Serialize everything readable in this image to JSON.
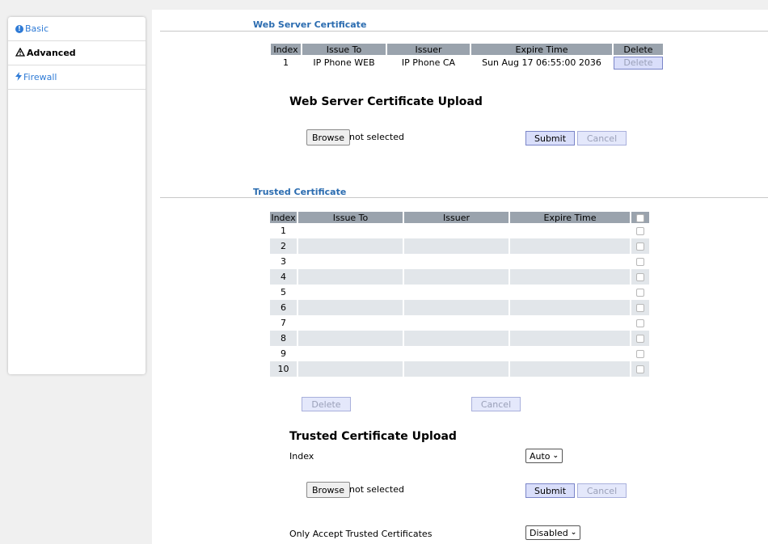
{
  "sidebar": {
    "items": [
      {
        "label": "Basic"
      },
      {
        "label": "Advanced"
      },
      {
        "label": "Firewall"
      }
    ]
  },
  "web_server": {
    "title": "Web Server Certificate",
    "columns": [
      "Index",
      "Issue To",
      "Issuer",
      "Expire Time",
      "Delete"
    ],
    "rows": [
      {
        "index": "1",
        "issue_to": "IP Phone WEB",
        "issuer": "IP Phone CA",
        "expire": "Sun Aug 17 06:55:00 2036",
        "delete_label": "Delete"
      }
    ],
    "upload_heading": "Web Server Certificate Upload",
    "browse_label": "Browse",
    "file_status": "not selected",
    "submit_label": "Submit",
    "cancel_label": "Cancel"
  },
  "trusted": {
    "title": "Trusted Certificate",
    "columns": [
      "Index",
      "Issue To",
      "Issuer",
      "Expire Time"
    ],
    "rows": [
      "1",
      "2",
      "3",
      "4",
      "5",
      "6",
      "7",
      "8",
      "9",
      "10"
    ],
    "delete_label": "Delete",
    "cancel_label": "Cancel",
    "upload_heading": "Trusted Certificate Upload",
    "index_label": "Index",
    "index_value": "Auto",
    "browse_label": "Browse",
    "file_status": "not selected",
    "submit_label": "Submit",
    "upload_cancel_label": "Cancel",
    "only_accept_label": "Only Accept Trusted Certificates",
    "only_accept_value": "Disabled"
  },
  "colors": {
    "link": "#2f7bd6",
    "section_title": "#2b6cb0",
    "header_bg": "#9aa3ad",
    "row_alt": "#e2e6ea",
    "button_bg": "#d9defa"
  }
}
